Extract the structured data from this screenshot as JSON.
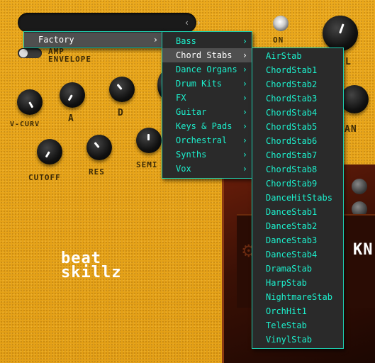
{
  "plugin": {
    "power_label": "ON",
    "amp_label": "AMP",
    "envelope_label": "ENVELOPE",
    "knob_labels": {
      "vcurv": "V-CURV",
      "a": "A",
      "d": "D",
      "cutoff": "CUTOFF",
      "res": "RES",
      "semi": "SEMI",
      "vol_partial": "L",
      "pan_partial": "AN"
    },
    "logo": {
      "line1": "beat",
      "line2": "skillz"
    },
    "synth_partial_text": "KN"
  },
  "menus": {
    "level1": {
      "items": [
        {
          "label": "Factory",
          "has_submenu": true,
          "selected": true
        }
      ]
    },
    "level2": {
      "items": [
        {
          "label": "Bass",
          "has_submenu": true
        },
        {
          "label": "Chord Stabs",
          "has_submenu": true,
          "selected": true
        },
        {
          "label": "Dance Organs",
          "has_submenu": true
        },
        {
          "label": "Drum Kits",
          "has_submenu": true
        },
        {
          "label": "FX",
          "has_submenu": true
        },
        {
          "label": "Guitar",
          "has_submenu": true
        },
        {
          "label": "Keys & Pads",
          "has_submenu": true
        },
        {
          "label": "Orchestral",
          "has_submenu": true
        },
        {
          "label": "Synths",
          "has_submenu": true
        },
        {
          "label": "Vox",
          "has_submenu": true
        }
      ]
    },
    "level3": {
      "items": [
        "AirStab",
        "ChordStab1",
        "ChordStab2",
        "ChordStab3",
        "ChordStab4",
        "ChordStab5",
        "ChordStab6",
        "ChordStab7",
        "ChordStab8",
        "ChordStab9",
        "DanceHitStabs",
        "DanceStab1",
        "DanceStab2",
        "DanceStab3",
        "DanceStab4",
        "DramaStab",
        "HarpStab",
        "NightmareStab",
        "OrchHit1",
        "TeleStab",
        "VinylStab"
      ]
    }
  },
  "colors": {
    "menu_text": "#1cf0cd",
    "menu_border": "#1ecfb0",
    "background": "#e8a61a"
  },
  "icons": {
    "chevron": "chevron-right-icon",
    "prev": "chevron-left-icon",
    "next": "chevron-right-icon"
  }
}
